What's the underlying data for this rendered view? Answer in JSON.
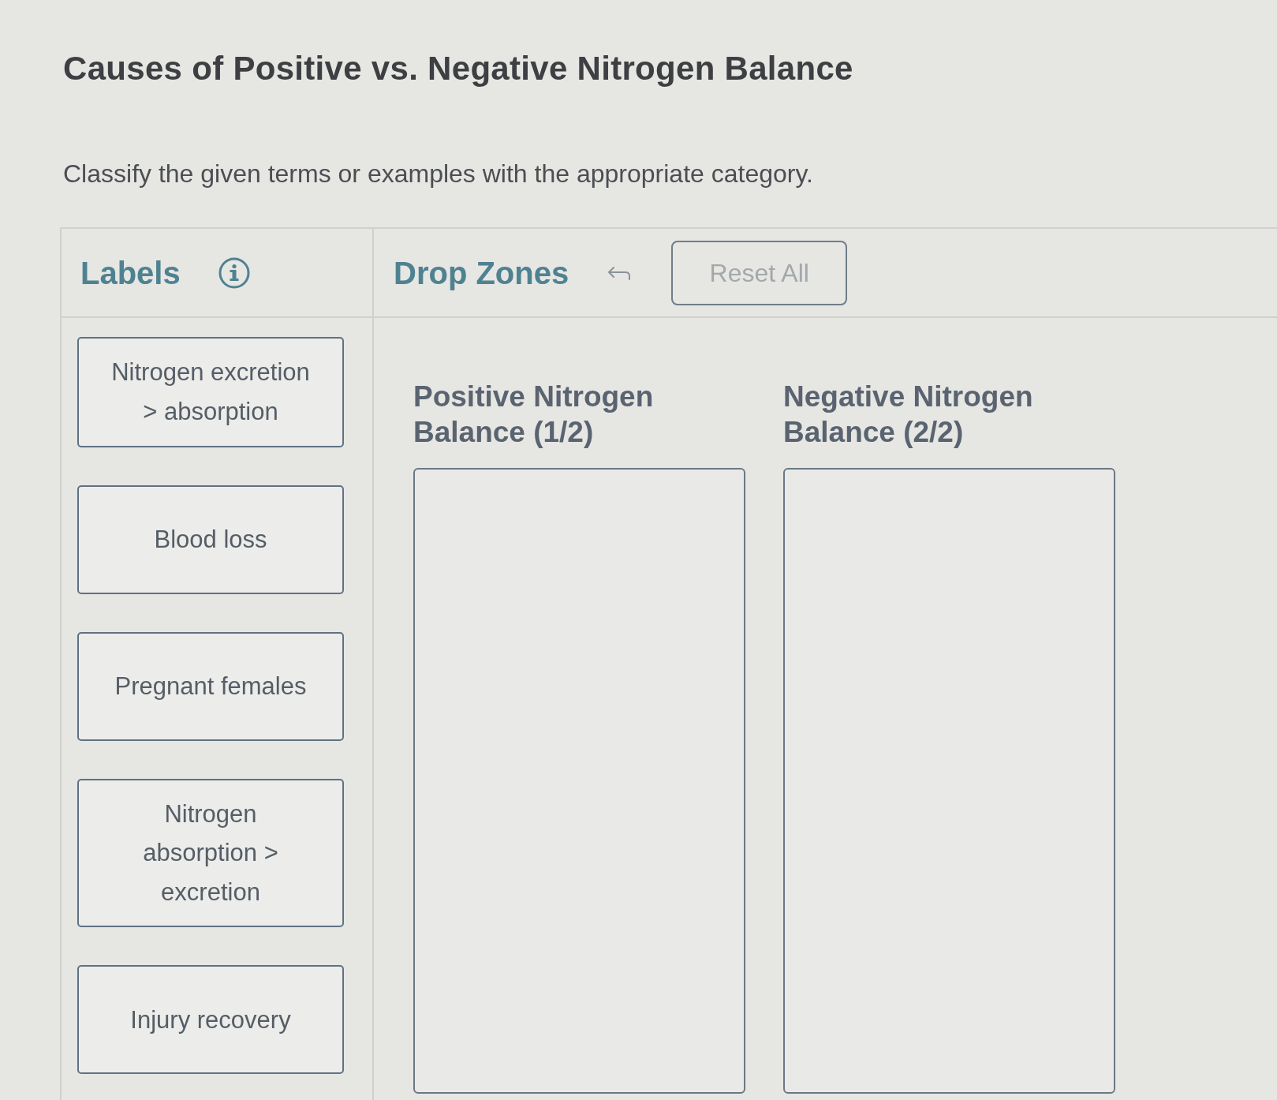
{
  "title": "Causes of Positive vs. Negative Nitrogen Balance",
  "instructions": "Classify the given terms or examples with the appropriate category.",
  "labels_panel": {
    "heading": "Labels",
    "items": [
      {
        "label": "Nitrogen excretion > absorption"
      },
      {
        "label": "Blood loss"
      },
      {
        "label": "Pregnant females"
      },
      {
        "label": "Nitrogen absorption > excretion"
      },
      {
        "label": "Injury recovery"
      }
    ]
  },
  "drop_zones_panel": {
    "heading": "Drop Zones",
    "reset_button": {
      "label": "Reset All",
      "disabled": true
    },
    "zones": [
      {
        "title": "Positive Nitrogen Balance (1/2)"
      },
      {
        "title": "Negative Nitrogen Balance (2/2)"
      }
    ]
  }
}
